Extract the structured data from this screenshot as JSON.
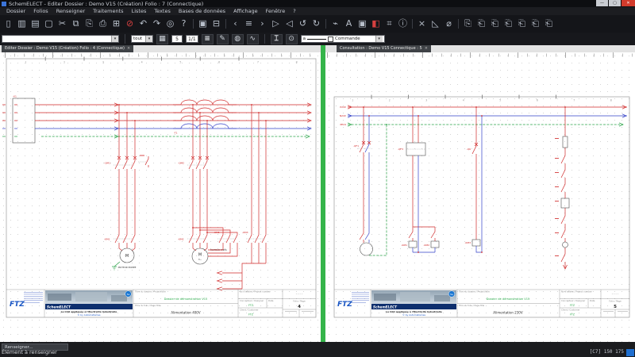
{
  "window": {
    "title": "SchemELECT - Editer  Dossier : Demo V15  (Création)  Folio : 7  (Connectique)",
    "controls": {
      "minimize": "—",
      "maximize": "▢",
      "close": "✕"
    }
  },
  "menu": {
    "items": [
      "Dossier",
      "Folios",
      "Renseigner",
      "Traitements",
      "Listes",
      "Textes",
      "Bases de données",
      "Affichage",
      "Fenêtre",
      "?"
    ]
  },
  "toolbar_main": {
    "icons": [
      {
        "name": "new-folio",
        "glyph": "▯"
      },
      {
        "name": "open-dossier",
        "glyph": "▥"
      },
      {
        "name": "save",
        "glyph": "▤"
      },
      {
        "name": "select-zone",
        "glyph": "▢"
      },
      {
        "name": "cut",
        "glyph": "✂"
      },
      {
        "name": "copy",
        "glyph": "⧉"
      },
      {
        "name": "paste",
        "glyph": "⎘"
      },
      {
        "name": "print",
        "glyph": "⎙"
      },
      {
        "name": "print-setup",
        "glyph": "⊞"
      },
      {
        "name": "abort",
        "glyph": "⊘",
        "red": true
      },
      {
        "name": "undo",
        "glyph": "↶"
      },
      {
        "name": "redo",
        "glyph": "↷"
      },
      {
        "name": "refresh",
        "glyph": "◎"
      },
      {
        "name": "help",
        "glyph": "?"
      },
      {
        "sep": true
      },
      {
        "name": "window-cascade",
        "glyph": "▣"
      },
      {
        "name": "window-tile",
        "glyph": "⊟"
      },
      {
        "sep": true
      },
      {
        "name": "previous-folio",
        "glyph": "‹"
      },
      {
        "name": "folio-list",
        "glyph": "≡"
      },
      {
        "name": "next-folio",
        "glyph": "›"
      },
      {
        "name": "cursor-select",
        "glyph": "▷"
      },
      {
        "name": "cursor-pan",
        "glyph": "◁"
      },
      {
        "name": "rotate-left",
        "glyph": "↺"
      },
      {
        "name": "rotate-right",
        "glyph": "↻"
      },
      {
        "sep": true
      },
      {
        "name": "insert-wire",
        "glyph": "⌁"
      },
      {
        "name": "insert-text",
        "glyph": "A"
      },
      {
        "name": "insert-block",
        "glyph": "▣"
      },
      {
        "name": "fill-color",
        "glyph": "◧",
        "red": true
      },
      {
        "name": "snap-grid",
        "glyph": "⌗"
      },
      {
        "name": "element-info",
        "glyph": "ⓘ"
      },
      {
        "sep": true
      },
      {
        "name": "delete-element",
        "glyph": "×"
      },
      {
        "name": "measure",
        "glyph": "◺"
      },
      {
        "name": "hide-layer",
        "glyph": "⌀"
      },
      {
        "sep": true
      },
      {
        "name": "folio-clipboard",
        "glyph": "⎘"
      },
      {
        "name": "folio-copy-1",
        "glyph": "⎗"
      },
      {
        "name": "folio-copy-2",
        "glyph": "⎗"
      },
      {
        "name": "folio-copy-3",
        "glyph": "⎗"
      },
      {
        "name": "folio-copy-4",
        "glyph": "⎗"
      },
      {
        "name": "folio-copy-5",
        "glyph": "⎗"
      },
      {
        "name": "folio-copy-6",
        "glyph": "⎗"
      }
    ]
  },
  "toolbar_edit": {
    "search_value": "",
    "filter_value": "tout",
    "grid_size": "5",
    "page_indicator": "1/1",
    "line_prefix": "a",
    "line_label": "Commande",
    "dropdown_arrow": "▾",
    "glyphs": {
      "grid": "▦",
      "layers": "≡",
      "pencil": "✎",
      "lamp": "◍",
      "curves": "∿",
      "cable": "⌶",
      "node": "⊙"
    }
  },
  "panes": {
    "close_glyph": "×",
    "left": {
      "tab": "Editer  Dossier : Demo V15  (Création)  Folio : 4  (Connectique)",
      "columns": [
        "1",
        "2",
        "3",
        "4",
        "5",
        "6",
        "7",
        "8"
      ],
      "schematic": {
        "terminal": "-X1",
        "transformer": "-T1",
        "breaker1": "-QM1",
        "breaker2": "-QM2",
        "contactor1": "-KM1",
        "contactor2": "-KM2",
        "contactor_delta": "-KM5",
        "contactor_star": "-KM3",
        "motor1": "M",
        "motor1_caption": "MOTEUR POMPE",
        "motor2": "M",
        "motor2_sub": "3~",
        "motor2_caption": "MOTEUR TAPIS"
      },
      "titleblock": {
        "project": "Dossier de démonstration V15",
        "page_title": "Alimentation 400V",
        "designer": "FTZ",
        "date": "",
        "customer": "FTZ",
        "folio": "4",
        "revision": "- - - -"
      }
    },
    "right": {
      "tab": "Consultation : Demo V15  Connectique : 5",
      "columns": [
        "1",
        "2",
        "3",
        "4",
        "5",
        "6",
        "7",
        "8"
      ],
      "schematic": {
        "wire_p": "P24V",
        "wire_n": "N24V",
        "wire_pe": "PE24",
        "breaker1": "-QF1",
        "supply": "-QF3",
        "breaker2": "-Q6",
        "coil1": "-KM1",
        "coil2": "-KM2",
        "coil3": "-KM3"
      },
      "titleblock": {
        "project": "Dossier de démonstration V15",
        "page_title": "Alimentation 230V",
        "designer": "FTZ",
        "date": "",
        "customer": "FTZ",
        "folio": "5",
        "revision": "- - - -"
      }
    }
  },
  "titleblock_labels": {
    "project": "Titre du dossier / Project title",
    "page": "Titre du folio / Page title",
    "number": "No d'affaire / Project number",
    "designer": "Concepteur / Designer",
    "date": "Date",
    "customer": "Client / Customer",
    "folio": "Folio / Page"
  },
  "brand": {
    "logo": "FTZ",
    "name": "SchemELECT",
    "badge": "5e",
    "slogan": "La CAO appliquée à l'Électricité Industrielle",
    "link": "© by Automatismes"
  },
  "statusbar": {
    "button": "Renseigner...",
    "message": "Élément à renseigner",
    "coords": "[C7] 150 175"
  }
}
